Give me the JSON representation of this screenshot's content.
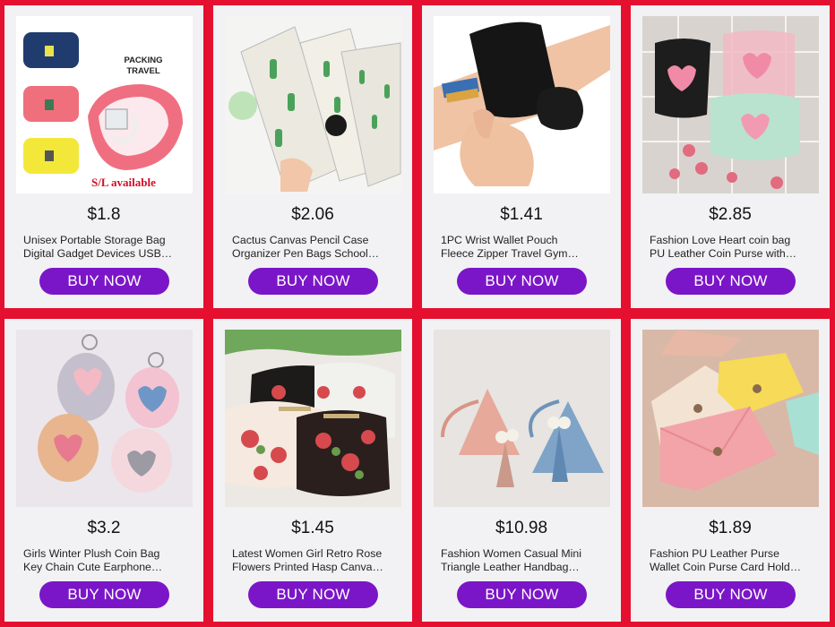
{
  "products": [
    {
      "price": "$1.8",
      "title_line1": "Unisex Portable Storage Bag",
      "title_line2": "Digital Gadget Devices USB…",
      "button": "BUY NOW",
      "image_icon": "storage-bag-image",
      "image_text": [
        "PACKING",
        "TRAVEL",
        "S/L available"
      ]
    },
    {
      "price": "$2.06",
      "title_line1": "Cactus Canvas Pencil Case",
      "title_line2": "Organizer Pen Bags School…",
      "button": "BUY NOW",
      "image_icon": "pencil-case-image"
    },
    {
      "price": "$1.41",
      "title_line1": "1PC Wrist Wallet Pouch",
      "title_line2": "Fleece Zipper Travel Gym…",
      "button": "BUY NOW",
      "image_icon": "wrist-wallet-image"
    },
    {
      "price": "$2.85",
      "title_line1": "Fashion Love Heart coin bag",
      "title_line2": "PU Leather Coin Purse with…",
      "button": "BUY NOW",
      "image_icon": "heart-coin-bag-image"
    },
    {
      "price": "$3.2",
      "title_line1": "Girls Winter Plush Coin Bag",
      "title_line2": "Key Chain Cute Earphone…",
      "button": "BUY NOW",
      "image_icon": "plush-coin-bag-image"
    },
    {
      "price": "$1.45",
      "title_line1": "Latest Women Girl Retro Rose",
      "title_line2": "Flowers Printed Hasp Canva…",
      "button": "BUY NOW",
      "image_icon": "rose-purse-image"
    },
    {
      "price": "$10.98",
      "title_line1": "Fashion Women Casual Mini",
      "title_line2": "Triangle Leather Handbag…",
      "button": "BUY NOW",
      "image_icon": "triangle-handbag-image"
    },
    {
      "price": "$1.89",
      "title_line1": "Fashion PU Leather Purse",
      "title_line2": "Wallet Coin Purse Card Hold…",
      "button": "BUY NOW",
      "image_icon": "leather-purse-image"
    }
  ],
  "colors": {
    "background": "#e5102f",
    "card": "#f2f2f4",
    "button": "#7b16c8",
    "button_text": "#ffffff"
  }
}
